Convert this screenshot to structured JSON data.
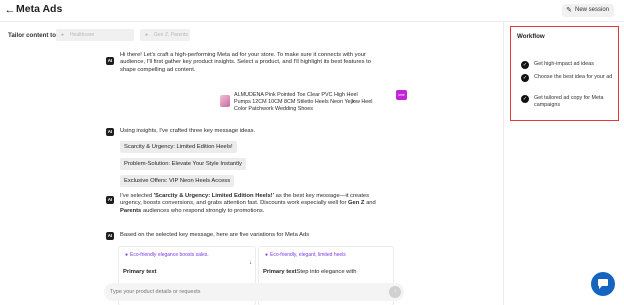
{
  "header": {
    "title": "Meta Ads",
    "new_session_label": "New session"
  },
  "tailor": {
    "label": "Tailor content to:",
    "audience_1": "Healthcare",
    "audience_2": "Gen Z, Parents"
  },
  "messages": {
    "intro": "Hi there! Let's craft a high-performing Meta ad for your store. To make sure it connects with your audience, I'll first gather key product insights. Select a product, and I'll highlight its best features to shape compelling ad content.",
    "product_name": "ALMUDENA Pink Pointed Toe Clear PVC High Heel Pumps 12CM 10CM 8CM Stiletto Heels Neon Yellow Heel Color Patchwork Wedding Shoes",
    "product_badge": "sme",
    "key_intro": "Using insights, I've crafted three key message ideas.",
    "key_messages": [
      "Scarcity & Urgency: Limited Edition Heels!",
      "Problem-Solution: Elevate Your Style Instantly",
      "Exclusive Offers: VIP Neon Heels Access"
    ],
    "selected_pre": "I've selected ",
    "selected_key": "'Scarcity & Urgency: Limited Edition Heels!'",
    "selected_mid": " as the best key message—it creates urgency, boosts conversions, and grabs attention fast. Discounts work especially well for ",
    "selected_gen": "Gen Z",
    "selected_and": " and ",
    "selected_parents": "Parents",
    "selected_post": " audiences who respond strongly to promotions.",
    "variations_intro": "Based on the selected key message, here are five variations for Meta Ads"
  },
  "variations": [
    {
      "tag": "Eco-friendly elegance boosts sales.",
      "heading": "Primary text",
      "body": ""
    },
    {
      "tag": "Eco-friendly, elegant, limited heels",
      "heading": "Primary text",
      "body": "Step into elegance with"
    }
  ],
  "input": {
    "placeholder": "Type your product details or requests"
  },
  "workflow": {
    "title": "Workflow",
    "steps": [
      "Get high-impact ad ideas",
      "Choose the best idea for your ad",
      "Get tailored ad copy for Meta campaigns"
    ]
  },
  "colors": {
    "workflow_border": "#e53935",
    "accent_purple": "#7c3aed",
    "chat_button": "#1565c0"
  }
}
